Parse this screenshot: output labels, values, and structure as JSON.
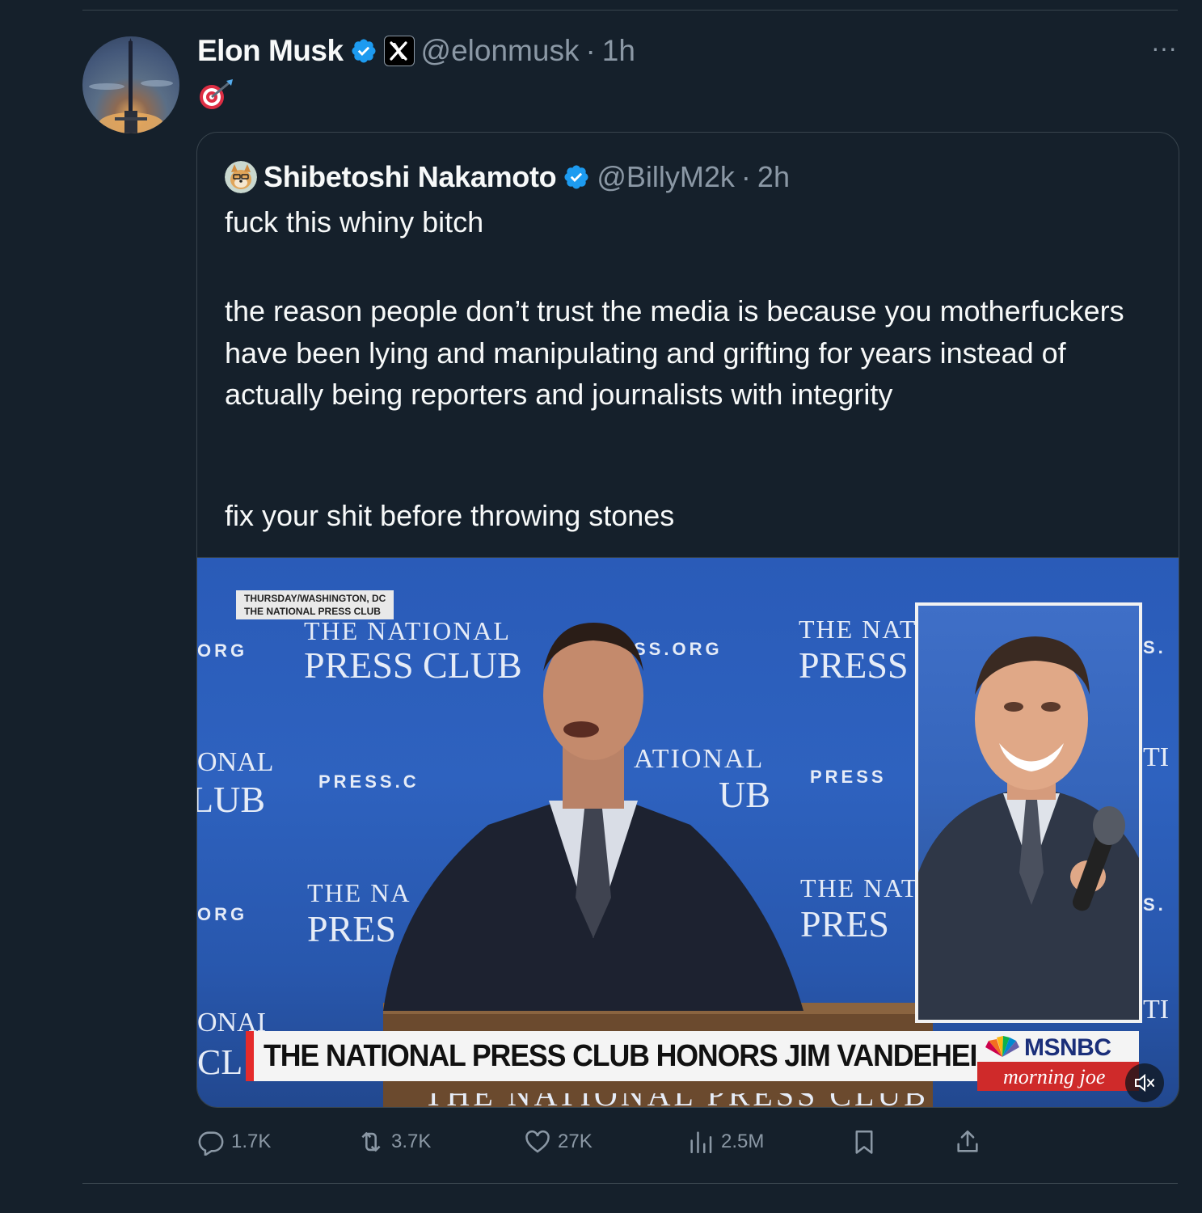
{
  "post": {
    "author": {
      "name": "Elon Musk",
      "handle": "@elonmusk",
      "time": "1h",
      "verified": true,
      "affiliate_badge": "X"
    },
    "text": "🎯",
    "separator": "·",
    "more_icon": "more-horizontal-icon",
    "more_label": "···"
  },
  "quote": {
    "author": {
      "name": "Shibetoshi Nakamoto",
      "handle": "@BillyM2k",
      "time": "2h",
      "verified": true
    },
    "text_line_1": "fuck this whiny bitch",
    "text_paragraph_2": "the reason people don’t trust the media is because you motherfuckers have been lying and manipulating and grifting for years instead of actually being reporters and journalists with integrity",
    "text_line_3": "fix your shit before throwing stones"
  },
  "media": {
    "dateline_1": "THURSDAY/WASHINGTON, DC",
    "dateline_2": "THE NATIONAL PRESS CLUB",
    "chyron": "THE NATIONAL PRESS CLUB HONORS JIM VANDEHEI",
    "network": "MSNBC",
    "show": "morning joe",
    "backdrop": {
      "the_national": "THE NATIONAL",
      "press_club": "PRESS CLUB",
      "the_nat": "THE NAT",
      "press": "PRESS",
      "the_na": "THE NA",
      "pres": "PRES",
      "onal": "ONAL",
      "lub": "LUB",
      "ational": "ATIONAL",
      "ub": "UB",
      "org": "ORG",
      "ss_org": "SS.ORG",
      "press_c": "PRESS.C",
      "press_w": "PRESS",
      "s_dot": "S.",
      "ti": "TI",
      "onal2": "ONAI",
      "cl": "CL",
      "bottom_strip": "THE NATIONAL PRESS CLUB"
    },
    "mute_icon": "volume-muted-icon"
  },
  "actions": {
    "replies": "1.7K",
    "reposts": "3.7K",
    "likes": "27K",
    "views": "2.5M"
  },
  "colors": {
    "background": "#15202b",
    "text_primary": "#f7f9f9",
    "text_secondary": "#8b98a5",
    "verified_blue": "#1d9bf0",
    "border": "#38444d"
  }
}
